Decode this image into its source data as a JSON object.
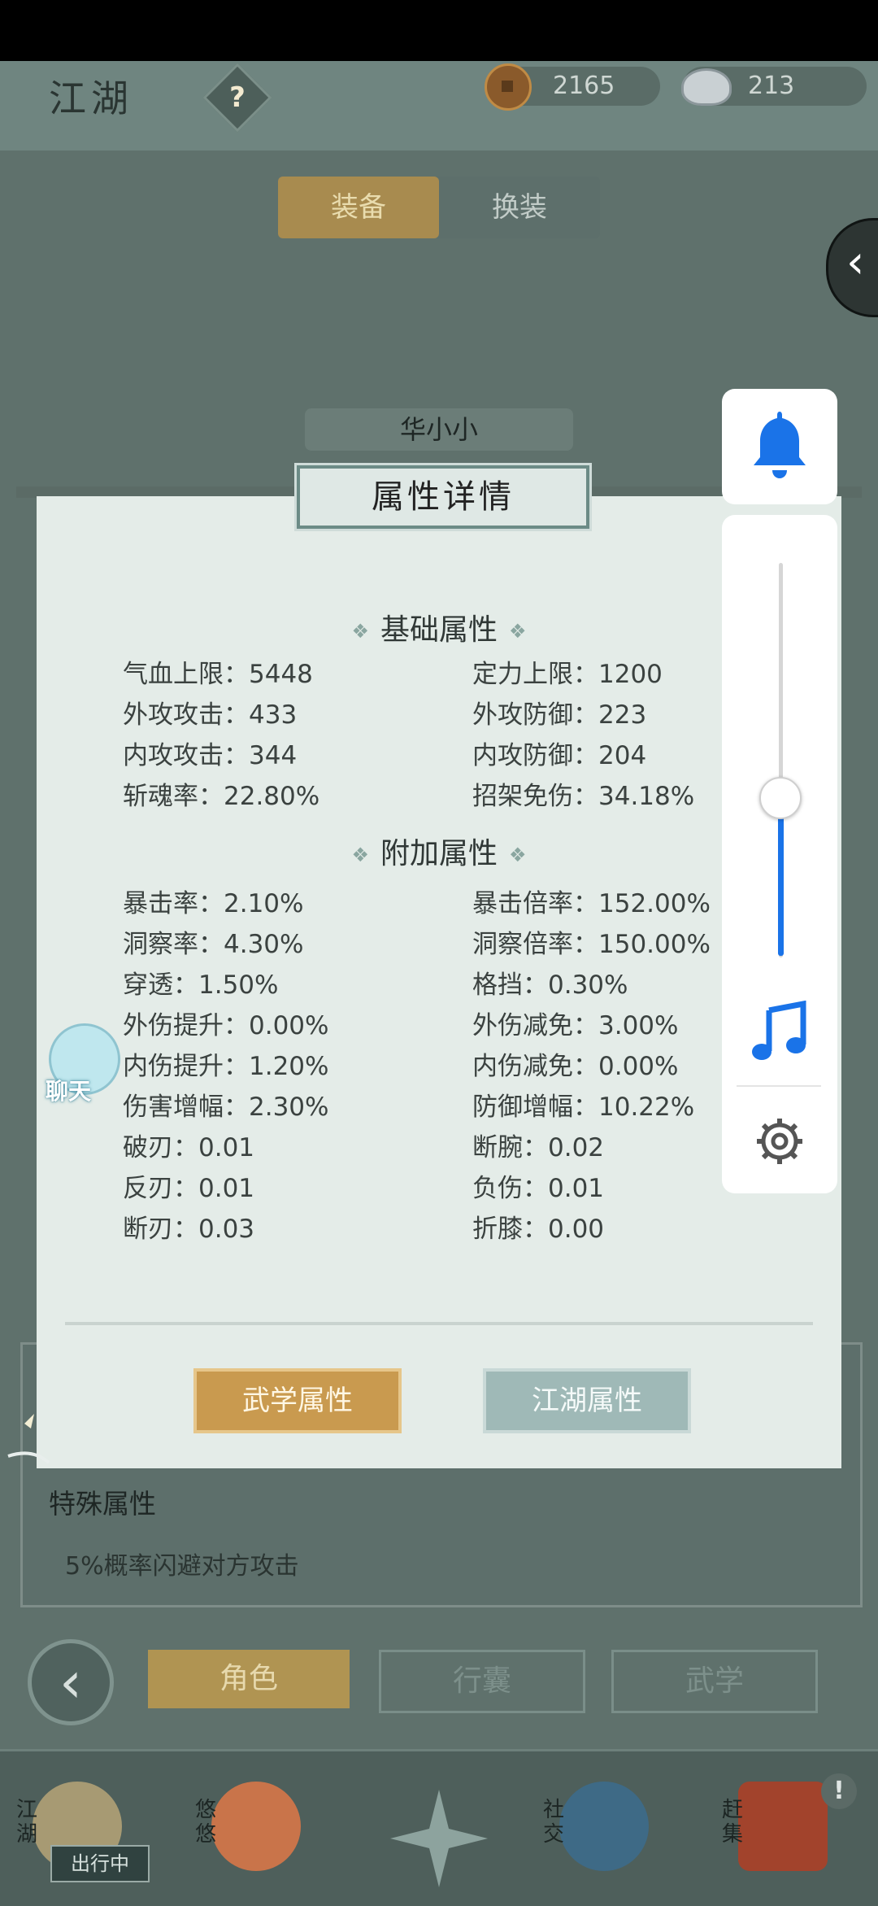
{
  "header": {
    "title": "江湖",
    "help_icon_label": "?",
    "currencies": [
      {
        "icon": "copper-coin-icon",
        "value": "2165"
      },
      {
        "icon": "silver-ingot-icon",
        "value": "213"
      }
    ]
  },
  "tabs": {
    "equip": "装备",
    "change_outfit": "换装"
  },
  "character_name": "华小小",
  "panel": {
    "title": "属性详情",
    "basic_section": "基础属性",
    "basic_stats": [
      "气血上限：5448",
      "定力上限：1200",
      "外攻攻击：433",
      "外攻防御：223",
      "内攻攻击：344",
      "内攻防御：204",
      "斩魂率：22.80%",
      "招架免伤：34.18%"
    ],
    "extra_section": "附加属性",
    "extra_stats": [
      "暴击率：2.10%",
      "暴击倍率：152.00%",
      "洞察率：4.30%",
      "洞察倍率：150.00%",
      "穿透：1.50%",
      "格挡：0.30%",
      "外伤提升：0.00%",
      "外伤减免：3.00%",
      "内伤提升：1.20%",
      "内伤减免：0.00%",
      "伤害增幅：2.30%",
      "防御增幅：10.22%",
      "破刃：0.01",
      "断腕：0.02",
      "反刃：0.01",
      "负伤：0.01",
      "断刃：0.03",
      "折膝：0.00"
    ],
    "btn_martial": "武学属性",
    "btn_jianghu": "江湖属性"
  },
  "special": {
    "title": "特殊属性",
    "text": "5%概率闪避对方攻击"
  },
  "nav": {
    "role": "角色",
    "bag": "行囊",
    "martial": "武学"
  },
  "dock": [
    {
      "label": "江湖",
      "tag": "出行中"
    },
    {
      "label": "悠悠"
    },
    {
      "label": ""
    },
    {
      "label": "社交"
    },
    {
      "label": "赶集"
    }
  ],
  "chat_label": "聊天",
  "alert": "!",
  "colors": {
    "accent_gold": "#c99a4f",
    "accent_teal": "#9fb9b7",
    "slider_blue": "#1a73e8",
    "panel_bg": "#e4ece8"
  }
}
